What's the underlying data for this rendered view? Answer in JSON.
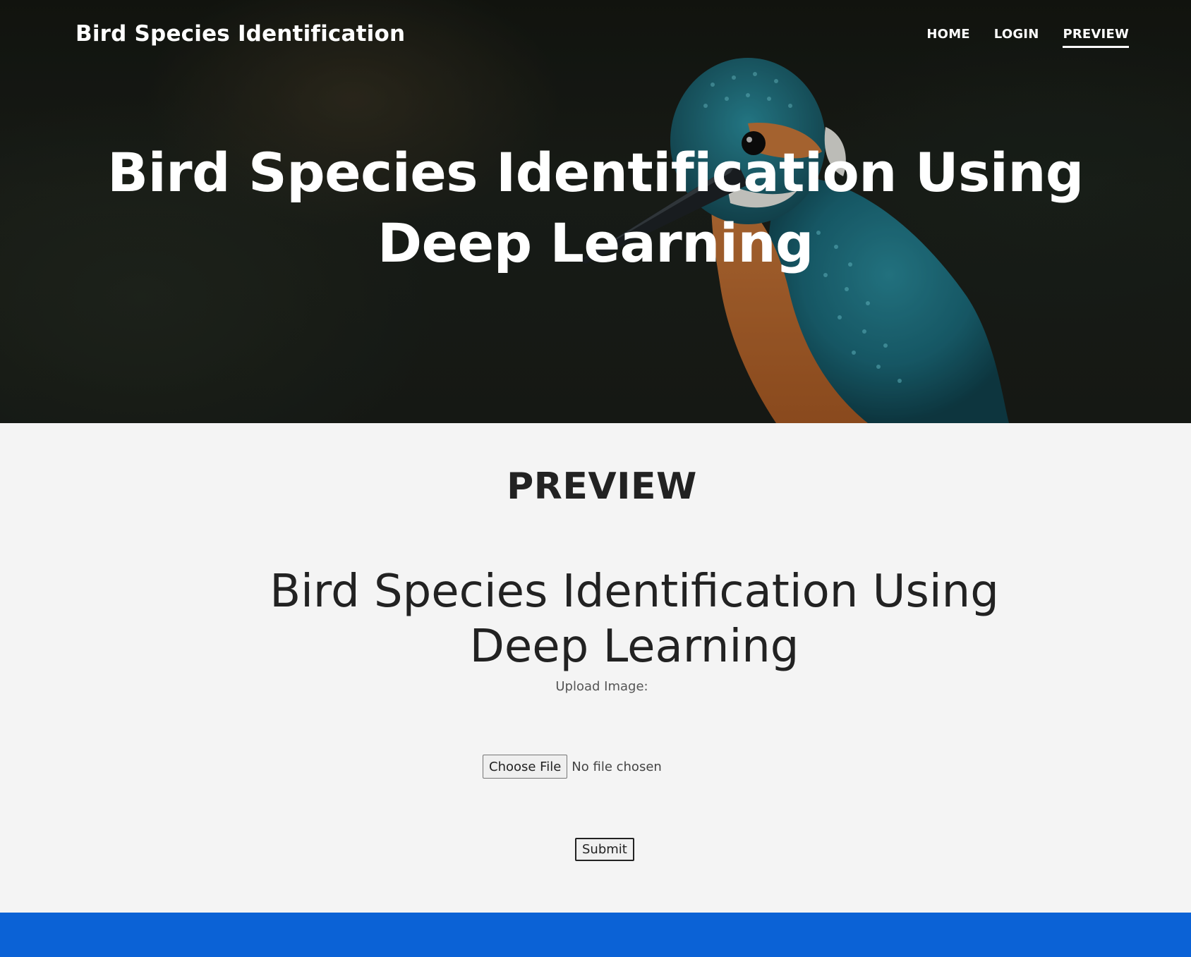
{
  "navbar": {
    "brand": "Bird Species Identification",
    "links": [
      {
        "label": "HOME",
        "active": false
      },
      {
        "label": "LOGIN",
        "active": false
      },
      {
        "label": "PREVIEW",
        "active": true
      }
    ]
  },
  "hero": {
    "title": "Bird Species Identification Using Deep Learning",
    "image": "kingfisher-photo"
  },
  "main": {
    "section_heading": "PREVIEW",
    "model_title": "Bird Species Identification Using Deep Learning",
    "upload_label": "Upload Image:",
    "file_input": {
      "button_label": "Choose File",
      "status": "No file chosen"
    },
    "submit_label": "Submit"
  },
  "colors": {
    "footer": "#0b62d6",
    "page_background": "#f4f4f4",
    "heading_text": "#222222"
  }
}
